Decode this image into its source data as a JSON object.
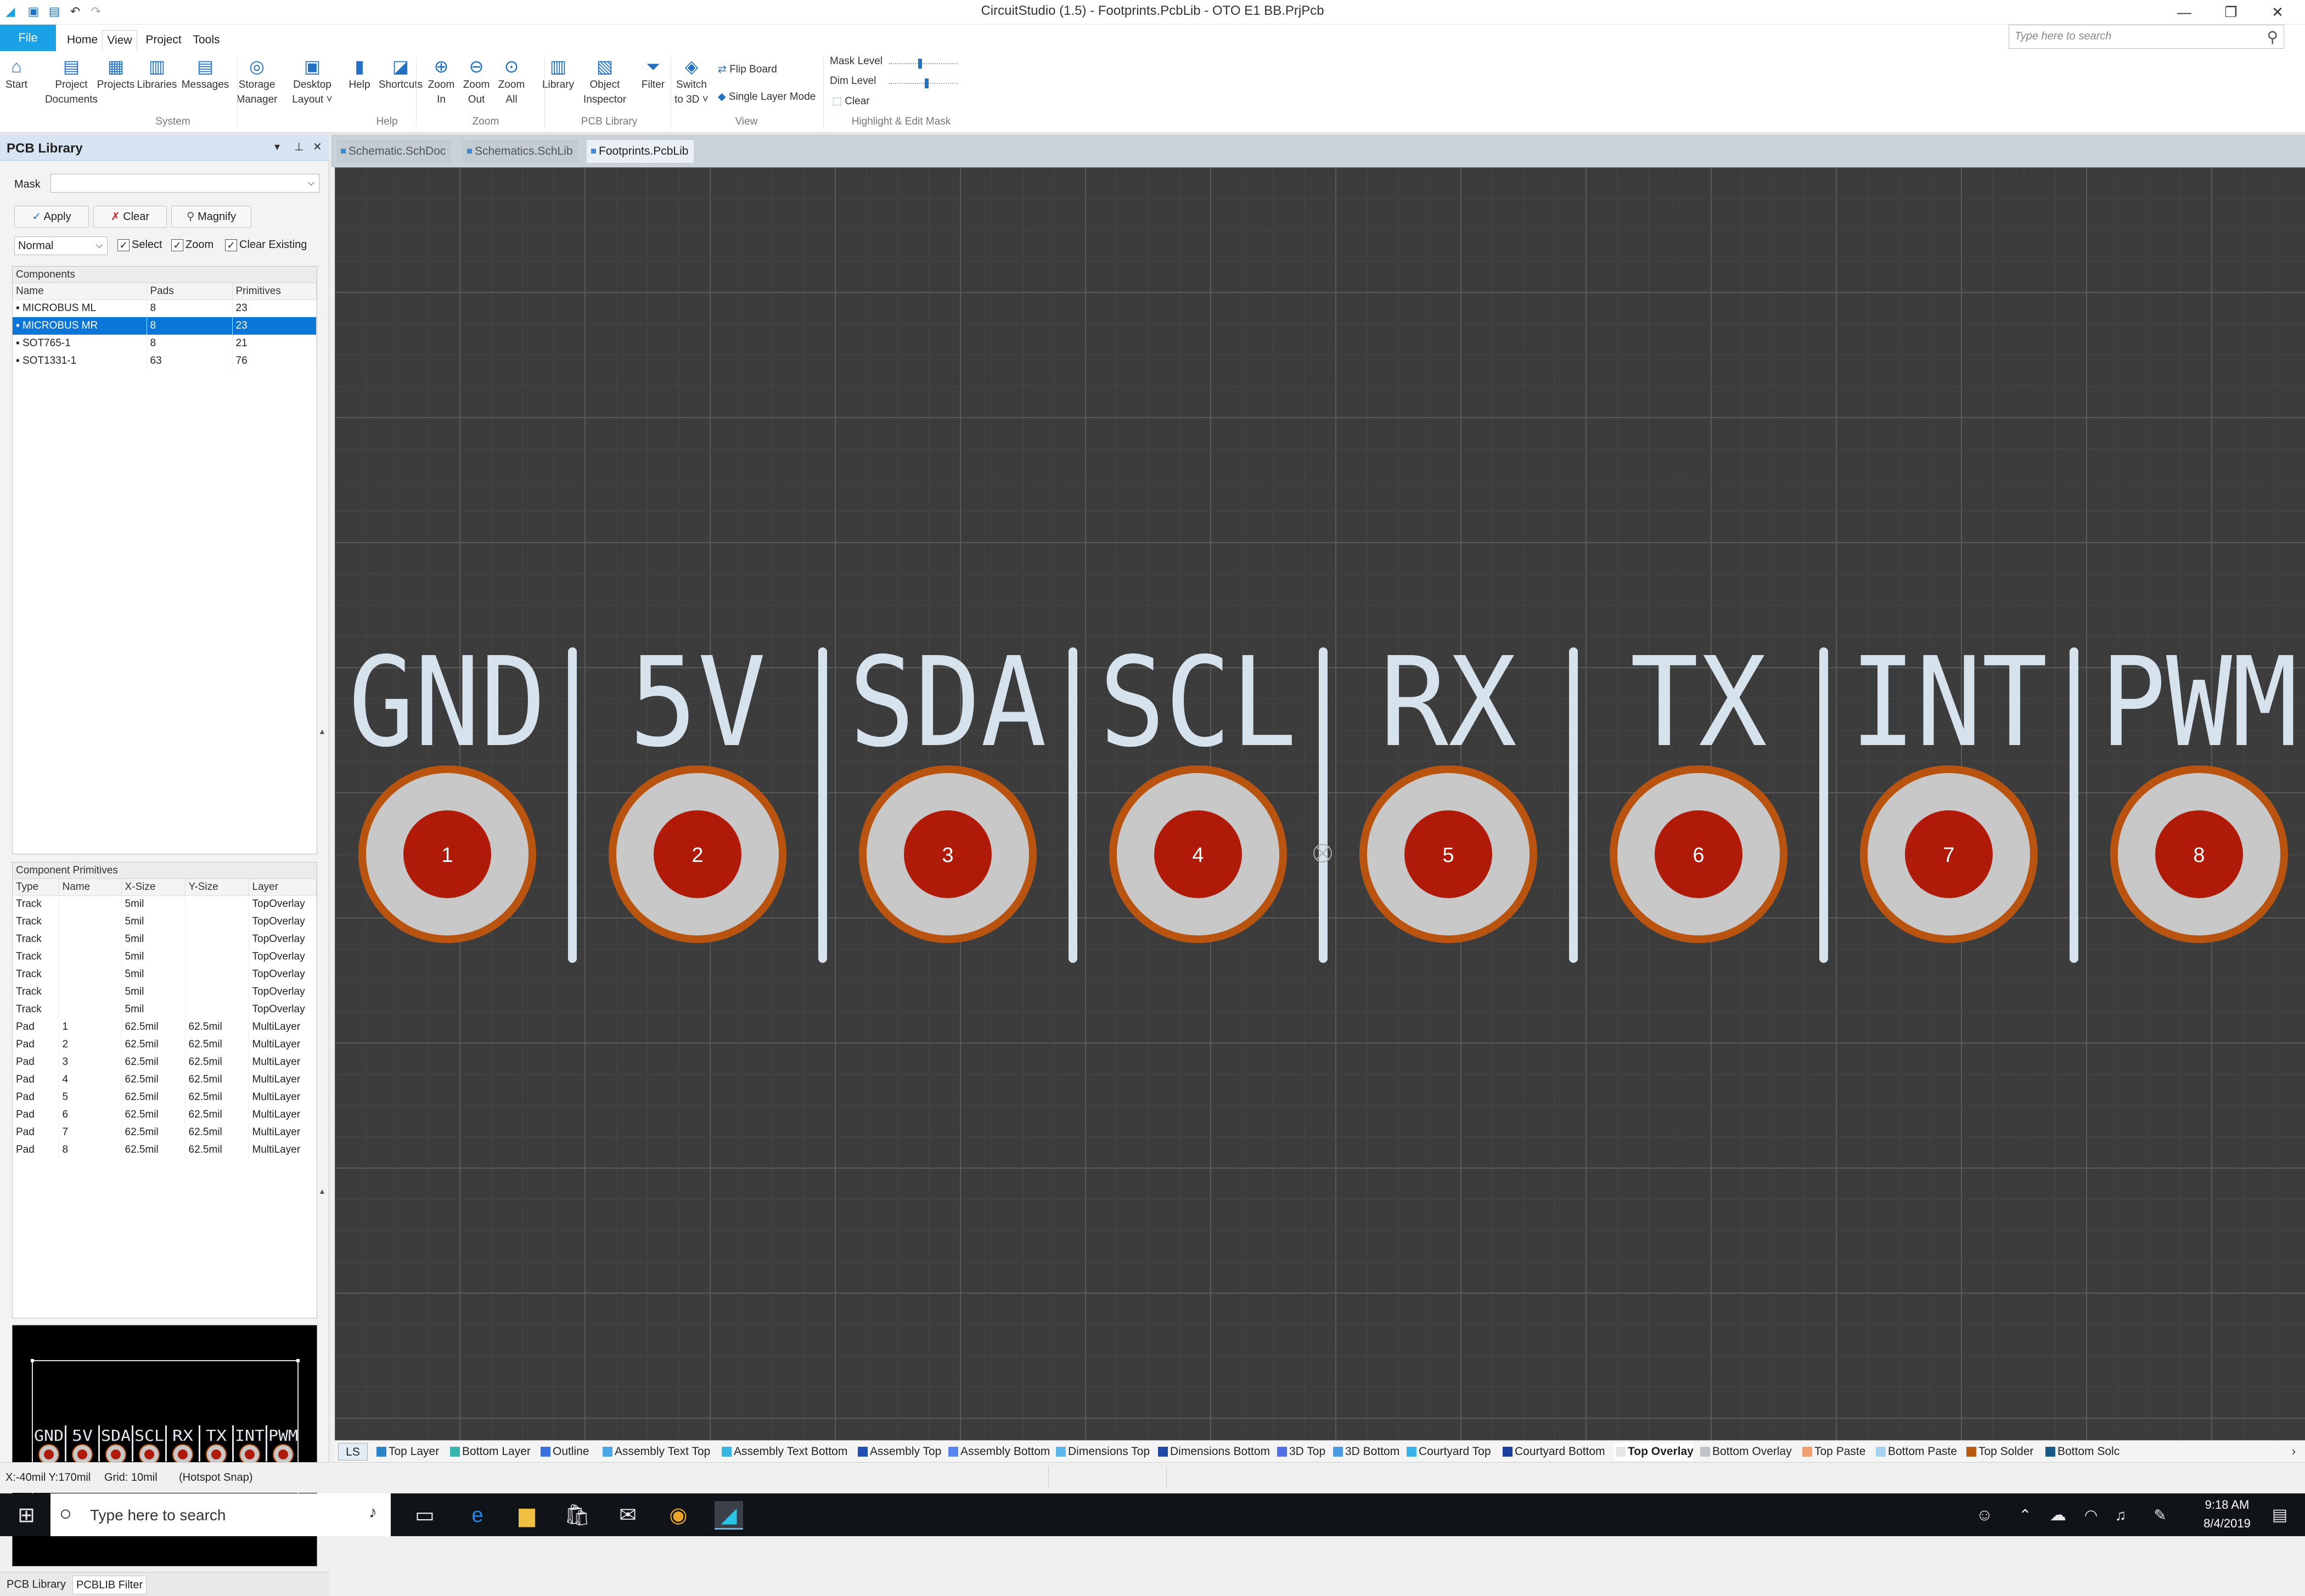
{
  "titlebar": {
    "title": "CircuitStudio (1.5) - Footprints.PcbLib - OTO E1 BB.PrjPcb",
    "minimize": "—",
    "restore": "❐",
    "close": "✕"
  },
  "ribbon_tabs": [
    "File",
    "Home",
    "View",
    "Project",
    "Tools"
  ],
  "search": {
    "placeholder": "Type here to search"
  },
  "ribbon": {
    "buttons": [
      {
        "label": "Start",
        "icon": "home-icon"
      },
      {
        "label": "Project\nDocuments",
        "icon": "project-documents-icon"
      },
      {
        "label": "Projects",
        "icon": "projects-icon"
      },
      {
        "label": "Libraries",
        "icon": "libraries-icon"
      },
      {
        "label": "Messages",
        "icon": "messages-icon"
      },
      {
        "label": "Storage\nManager",
        "icon": "storage-manager-icon"
      },
      {
        "label": "Desktop\nLayout ˅",
        "icon": "desktop-layout-icon"
      },
      {
        "label": "Help",
        "icon": "help-icon"
      },
      {
        "label": "Shortcuts",
        "icon": "shortcuts-icon"
      },
      {
        "label": "Zoom\nIn",
        "icon": "zoom-in-icon"
      },
      {
        "label": "Zoom\nOut",
        "icon": "zoom-out-icon"
      },
      {
        "label": "Zoom\nAll",
        "icon": "zoom-all-icon"
      },
      {
        "label": "Library",
        "icon": "library-icon"
      },
      {
        "label": "Object\nInspector",
        "icon": "object-inspector-icon"
      },
      {
        "label": "Filter",
        "icon": "filter-icon"
      },
      {
        "label": "Switch\nto 3D ˅",
        "icon": "switch-3d-icon"
      }
    ],
    "groups": [
      "System",
      "Help",
      "Zoom",
      "PCB Library",
      "View",
      "Highlight & Edit Mask"
    ],
    "flip_board": "Flip Board",
    "single_layer_mode": "Single Layer Mode",
    "mask_level": "Mask Level",
    "dim_level": "Dim Level",
    "clear": "Clear",
    "mask_level_value": 0.45,
    "dim_level_value": 0.55
  },
  "panel": {
    "title": "PCB Library",
    "mask_label": "Mask",
    "apply": "Apply",
    "clear": "Clear",
    "magnify": "Magnify",
    "mode": "Normal",
    "select": "Select",
    "zoom": "Zoom",
    "clear_existing": "Clear Existing",
    "components_caption": "Components",
    "components_headers": [
      "Name",
      "Pads",
      "Primitives"
    ],
    "components": [
      {
        "name": "MICROBUS ML",
        "pads": "8",
        "primitives": "23",
        "selected": false
      },
      {
        "name": "MICROBUS MR",
        "pads": "8",
        "primitives": "23",
        "selected": true
      },
      {
        "name": "SOT765-1",
        "pads": "8",
        "primitives": "21",
        "selected": false
      },
      {
        "name": "SOT1331-1",
        "pads": "63",
        "primitives": "76",
        "selected": false
      }
    ],
    "primitives_caption": "Component Primitives",
    "primitives_headers": [
      "Type",
      "Name",
      "X-Size",
      "Y-Size",
      "Layer"
    ],
    "primitives": [
      [
        "Track",
        "",
        "5mil",
        "",
        "TopOverlay"
      ],
      [
        "Track",
        "",
        "5mil",
        "",
        "TopOverlay"
      ],
      [
        "Track",
        "",
        "5mil",
        "",
        "TopOverlay"
      ],
      [
        "Track",
        "",
        "5mil",
        "",
        "TopOverlay"
      ],
      [
        "Track",
        "",
        "5mil",
        "",
        "TopOverlay"
      ],
      [
        "Track",
        "",
        "5mil",
        "",
        "TopOverlay"
      ],
      [
        "Track",
        "",
        "5mil",
        "",
        "TopOverlay"
      ],
      [
        "Pad",
        "1",
        "62.5mil",
        "62.5mil",
        "MultiLayer"
      ],
      [
        "Pad",
        "2",
        "62.5mil",
        "62.5mil",
        "MultiLayer"
      ],
      [
        "Pad",
        "3",
        "62.5mil",
        "62.5mil",
        "MultiLayer"
      ],
      [
        "Pad",
        "4",
        "62.5mil",
        "62.5mil",
        "MultiLayer"
      ],
      [
        "Pad",
        "5",
        "62.5mil",
        "62.5mil",
        "MultiLayer"
      ],
      [
        "Pad",
        "6",
        "62.5mil",
        "62.5mil",
        "MultiLayer"
      ],
      [
        "Pad",
        "7",
        "62.5mil",
        "62.5mil",
        "MultiLayer"
      ],
      [
        "Pad",
        "8",
        "62.5mil",
        "62.5mil",
        "MultiLayer"
      ]
    ],
    "bottom_tabs": [
      "PCB Library",
      "PCBLIB Filter"
    ]
  },
  "doc_tabs": [
    {
      "label": "Schematic.SchDoc",
      "active": false
    },
    {
      "label": "Schematics.SchLib",
      "active": false
    },
    {
      "label": "Footprints.PcbLib",
      "active": true
    }
  ],
  "pins": [
    {
      "label": "GND",
      "number": "1"
    },
    {
      "label": "5V",
      "number": "2"
    },
    {
      "label": "SDA",
      "number": "3"
    },
    {
      "label": "SCL",
      "number": "4"
    },
    {
      "label": "RX",
      "number": "5"
    },
    {
      "label": "TX",
      "number": "6"
    },
    {
      "label": "INT",
      "number": "7"
    },
    {
      "label": "PWM",
      "number": "8"
    }
  ],
  "layers": {
    "ls": "LS",
    "items": [
      {
        "label": "Top Layer",
        "color": "#2c83c6"
      },
      {
        "label": "Bottom Layer",
        "color": "#37b5b0"
      },
      {
        "label": "Outline",
        "color": "#3a6fe0"
      },
      {
        "label": "Assembly Text Top",
        "color": "#49a7e8"
      },
      {
        "label": "Assembly Text Bottom",
        "color": "#38b6e2"
      },
      {
        "label": "Assembly Top",
        "color": "#1f4fb0"
      },
      {
        "label": "Assembly Bottom",
        "color": "#5a86f0"
      },
      {
        "label": "Dimensions Top",
        "color": "#5cb6ea"
      },
      {
        "label": "Dimensions Bottom",
        "color": "#1e4aa5"
      },
      {
        "label": "3D Top",
        "color": "#5270e8"
      },
      {
        "label": "3D Bottom",
        "color": "#4a9ae6"
      },
      {
        "label": "Courtyard Top",
        "color": "#36b2e6"
      },
      {
        "label": "Courtyard Bottom",
        "color": "#1c3f9c"
      },
      {
        "label": "Top Overlay",
        "color": "#e6e6e6"
      },
      {
        "label": "Bottom Overlay",
        "color": "#c0c4c8"
      },
      {
        "label": "Top Paste",
        "color": "#f0a070"
      },
      {
        "label": "Bottom Paste",
        "color": "#a6d2ee"
      },
      {
        "label": "Top Solder",
        "color": "#b85a12"
      },
      {
        "label": "Bottom Solc",
        "color": "#1a5a8a"
      }
    ],
    "active": "Top Overlay",
    "scroll_arrow": "›"
  },
  "status": {
    "coords": "X:-40mil Y:170mil",
    "grid": "Grid: 10mil",
    "snap": "(Hotspot Snap)"
  },
  "taskbar": {
    "search_placeholder": "Type here to search",
    "time": "9:18 AM",
    "date": "8/4/2019"
  },
  "colors": {
    "canvas": "#3c3c3c",
    "overlay": "#d6e3ec",
    "pad_copper": "#b95410",
    "pad_ring": "#c8c8c8",
    "pad_hole": "#b01a08",
    "selection": "#0a76d8"
  }
}
